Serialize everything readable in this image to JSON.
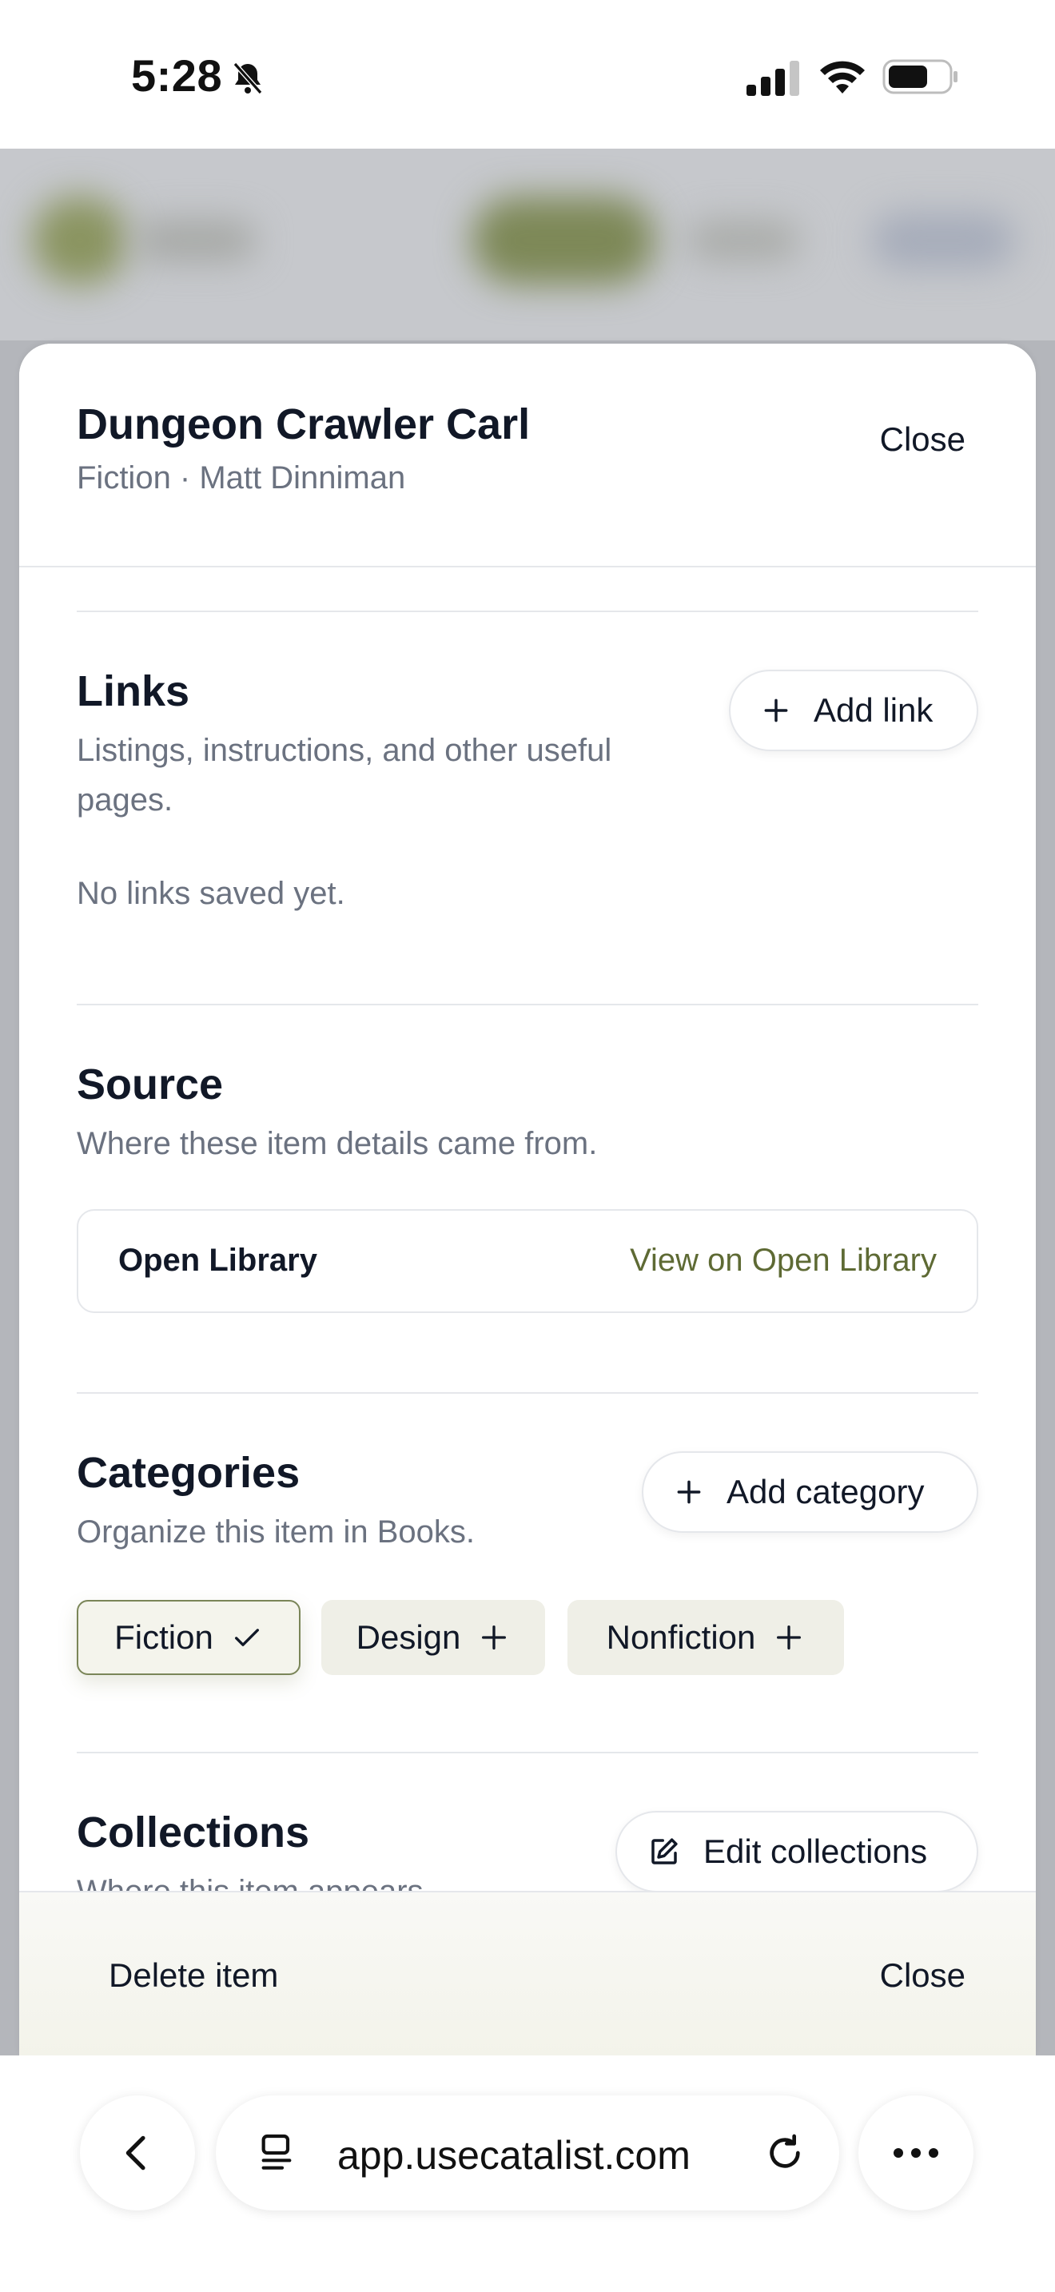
{
  "status_bar": {
    "time": "5:28"
  },
  "sheet": {
    "title": "Dungeon Crawler Carl",
    "subtitle": "Fiction · Matt Dinniman",
    "close_label": "Close"
  },
  "links": {
    "title": "Links",
    "description_line1": "Listings, instructions, and other useful",
    "description_line2": "pages.",
    "add_label": "Add link",
    "empty_text": "No links saved yet."
  },
  "source": {
    "title": "Source",
    "description": "Where these item details came from.",
    "name": "Open Library",
    "link_label": "View on Open Library"
  },
  "categories": {
    "title": "Categories",
    "description": "Organize this item in Books.",
    "add_label": "Add category",
    "chips": [
      {
        "label": "Fiction",
        "selected": true
      },
      {
        "label": "Design",
        "selected": false
      },
      {
        "label": "Nonfiction",
        "selected": false
      }
    ]
  },
  "collections": {
    "title": "Collections",
    "description": "Where this item appears",
    "edit_label": "Edit collections"
  },
  "footer": {
    "delete_label": "Delete item",
    "close_label": "Close"
  },
  "browser": {
    "url": "app.usecatalist.com"
  },
  "colors": {
    "accent": "#5e6a34",
    "chip_bg": "#efefe7",
    "chip_selected_border": "#7a8558"
  }
}
